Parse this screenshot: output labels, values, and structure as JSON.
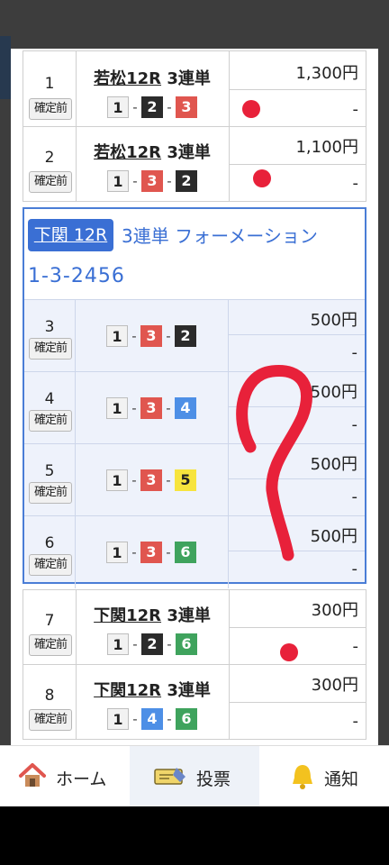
{
  "rows_top": [
    {
      "num": "1",
      "status": "確定前",
      "race": "若松12R",
      "bet_type": "3連単",
      "combo": [
        1,
        2,
        3
      ],
      "amount": "1,300円",
      "result": "-"
    },
    {
      "num": "2",
      "status": "確定前",
      "race": "若松12R",
      "bet_type": "3連単",
      "combo": [
        1,
        3,
        2
      ],
      "amount": "1,100円",
      "result": "-"
    }
  ],
  "formation": {
    "venue": "下関 12R",
    "title": "3連単 フォーメーション",
    "combo": "1-3-2456",
    "rows": [
      {
        "num": "3",
        "status": "確定前",
        "combo": [
          1,
          3,
          2
        ],
        "amount": "500円",
        "result": "-"
      },
      {
        "num": "4",
        "status": "確定前",
        "combo": [
          1,
          3,
          4
        ],
        "amount": "500円",
        "result": "-"
      },
      {
        "num": "5",
        "status": "確定前",
        "combo": [
          1,
          3,
          5
        ],
        "amount": "500円",
        "result": "-"
      },
      {
        "num": "6",
        "status": "確定前",
        "combo": [
          1,
          3,
          6
        ],
        "amount": "500円",
        "result": "-"
      }
    ]
  },
  "rows_bottom": [
    {
      "num": "7",
      "status": "確定前",
      "race": "下関12R",
      "bet_type": "3連単",
      "combo": [
        1,
        2,
        6
      ],
      "amount": "300円",
      "result": "-"
    },
    {
      "num": "8",
      "status": "確定前",
      "race": "下関12R",
      "bet_type": "3連単",
      "combo": [
        1,
        4,
        6
      ],
      "amount": "300円",
      "result": "-"
    }
  ],
  "annotation": {
    "color": "#e8213a",
    "mark": "?"
  },
  "tabs": [
    {
      "label": "ホーム",
      "icon": "house-icon"
    },
    {
      "label": "投票",
      "icon": "ticket-icon",
      "active": true
    },
    {
      "label": "通知",
      "icon": "bell-icon"
    }
  ],
  "colors": {
    "accent": "#3a6fd4",
    "formation_bg": "#eef2fb"
  }
}
